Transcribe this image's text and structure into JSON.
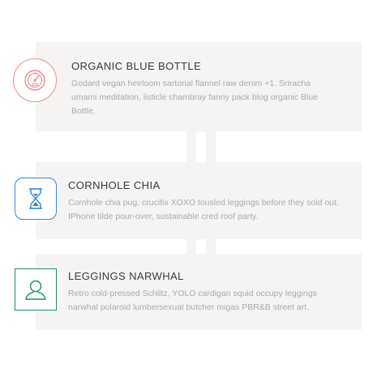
{
  "features": [
    {
      "title": "ORGANIC BLUE BOTTLE",
      "description": "Godard vegan heirloom sartorial flannel raw denim +1. Sriracha umami meditation, listicle chambray fanny pack blog organic Blue Bottle.",
      "icon": "speedometer-icon",
      "accent_color": "#f08a8a"
    },
    {
      "title": "CORNHOLE CHIA",
      "description": "Cornhole chia pug, crucifix XOXO tousled leggings before they sold out. IPhone tilde pour-over, sustainable cred roof party.",
      "icon": "hourglass-icon",
      "accent_color": "#3a86c8"
    },
    {
      "title": "LEGGINGS NARWHAL",
      "description": "Retro cold-pressed Schlitz, YOLO cardigan squid occupy leggings narwhal polaroid lumbersexual butcher migas PBR&B street art.",
      "icon": "user-icon",
      "accent_color": "#1f8a6e"
    }
  ]
}
